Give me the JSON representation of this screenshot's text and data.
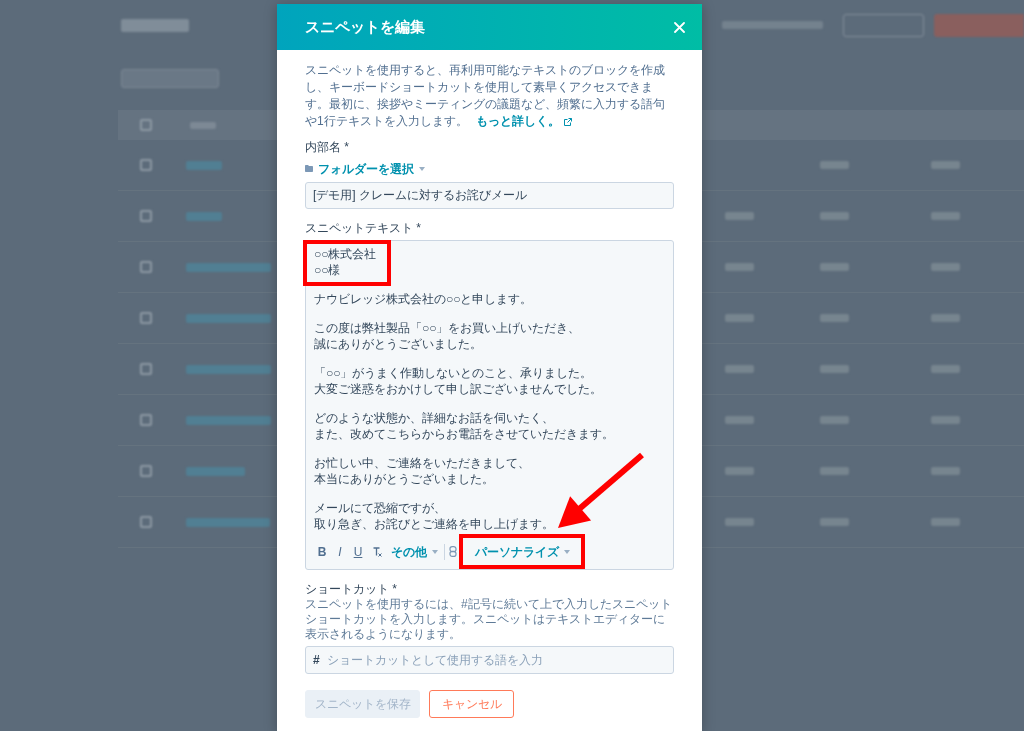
{
  "dialog": {
    "title": "スニペットを編集"
  },
  "intro": {
    "text": "スニペットを使用すると、再利用可能なテキストのブロックを作成し、キーボードショートカットを使用して素早くアクセスできます。最初に、挨拶やミーティングの議題など、頻繁に入力する語句や1行テキストを入力します。",
    "link": "もっと詳しく。"
  },
  "internal_name": {
    "label": "内部名 *",
    "folder_link": "フォルダーを選択",
    "value": "[デモ用] クレームに対するお詫びメール"
  },
  "snippet_text": {
    "label": "スニペットテキスト *",
    "paragraphs": [
      {
        "lines": [
          "○○株式会社",
          "○○様"
        ],
        "highlighted": true
      },
      {
        "lines": [
          "ナウビレッジ株式会社の○○と申します。"
        ],
        "highlighted": false
      },
      {
        "lines": [
          "この度は弊社製品「○○」をお買い上げいただき、",
          "誠にありがとうございました。"
        ],
        "highlighted": false
      },
      {
        "lines": [
          "「○○」がうまく作動しないとのこと、承りました。",
          "大変ご迷惑をおかけして申し訳ございませんでした。"
        ],
        "highlighted": false
      },
      {
        "lines": [
          "どのような状態か、詳細なお話を伺いたく、",
          "また、改めてこちらからお電話をさせていただきます。"
        ],
        "highlighted": false
      },
      {
        "lines": [
          "お忙しい中、ご連絡をいただきまして、",
          "本当にありがとうございました。"
        ],
        "highlighted": false
      },
      {
        "lines": [
          "メールにて恐縮ですが、",
          "取り急ぎ、お詫びとご連絡を申し上げます。"
        ],
        "highlighted": false
      }
    ],
    "toolbar": [
      {
        "kind": "bold",
        "label": "B",
        "highlighted": false
      },
      {
        "kind": "italic",
        "label": "I",
        "highlighted": false
      },
      {
        "kind": "underline",
        "label": "U",
        "highlighted": false
      },
      {
        "kind": "clear_format",
        "highlighted": false
      },
      {
        "kind": "dropdown",
        "label": "その他",
        "highlighted": false
      },
      {
        "kind": "separator",
        "highlighted": false
      },
      {
        "kind": "insert",
        "highlighted": false
      },
      {
        "kind": "dropdown",
        "label": "パーソナライズ",
        "highlighted": true
      }
    ]
  },
  "annotations": [
    {
      "kind": "arrow"
    }
  ],
  "shortcut": {
    "label": "ショートカット *",
    "help": "スニペットを使用するには、#記号に続いて上で入力したスニペットショートカットを入力します。スニペットはテキストエディターに表示されるようになります。",
    "prefix": "#",
    "placeholder": "ショートカットとして使用する語を入力"
  },
  "buttons": [
    {
      "kind": "primary",
      "label": "スニペットを保存",
      "disabled": true
    },
    {
      "kind": "secondary",
      "label": "キャンセル",
      "disabled": false
    }
  ]
}
